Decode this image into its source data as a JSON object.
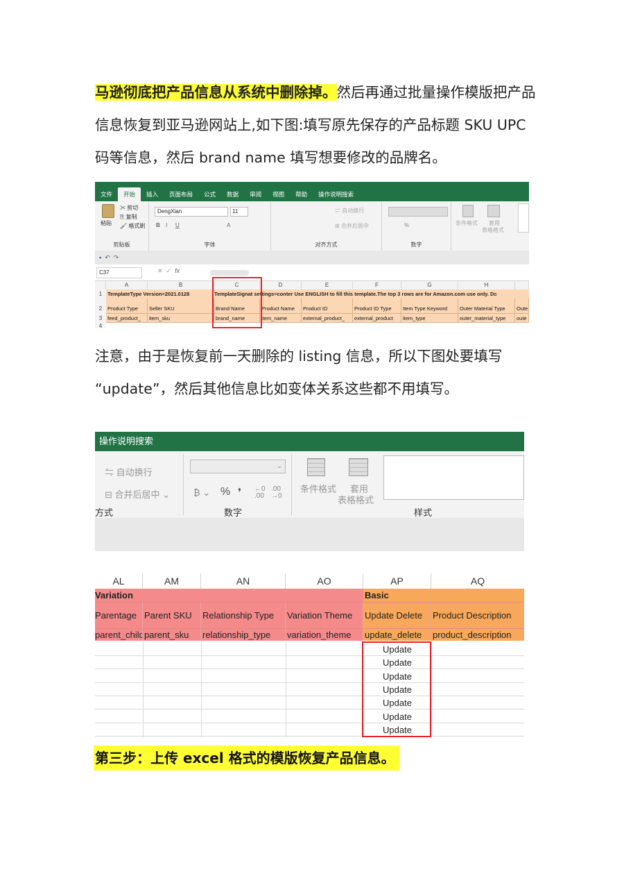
{
  "intro": {
    "highlight": "马逊彻底把产品信息从系统中删除掉。",
    "rest": "然后再通过批量操作模版把产品信息恢复到亚马逊网站上,如下图:填写原先保存的产品标题 SKU UPC码等信息，然后 brand name 填写想要修改的品牌名。"
  },
  "note": "注意，由于是恢复前一天删除的 listing 信息，所以下图处要填写 “update”，然后其他信息比如变体关系这些都不用填写。",
  "step3": "第三步：上传 excel 格式的模版恢复产品信息。",
  "shot1": {
    "tabs": [
      "文件",
      "开始",
      "插入",
      "页面布局",
      "公式",
      "数据",
      "审阅",
      "视图",
      "帮助",
      "操作说明搜索"
    ],
    "active_tab": "开始",
    "ribbon": {
      "paste": "粘贴",
      "cut": "剪切",
      "copy": "复制",
      "format_painter": "格式刷",
      "clipboard_group": "剪贴板",
      "font_name": "DengXian",
      "font_size": "11",
      "font_group": "字体",
      "wrap_text": "自动换行",
      "merge_center": "合并后居中",
      "align_group": "对齐方式",
      "number_group": "数字",
      "cond_format": "条件格式",
      "table_format_1": "套用",
      "table_format_2": "表格格式"
    },
    "name_box": "C37",
    "fx": "fx",
    "columns": [
      "A",
      "B",
      "C",
      "D",
      "E",
      "F",
      "G",
      "H"
    ],
    "rows": [
      "1",
      "2",
      "3",
      "4"
    ],
    "row1": "TemplateType Version=2021.0128",
    "row1_b": "TemplateSignat settings=conter Use ENGLISH to fill this template.The top 3 rows are for Amazon.com use only. Dc",
    "row2": [
      "Product Type",
      "Seller SKU",
      "Brand Name",
      "Product Name",
      "Product ID",
      "Product ID Type",
      "Item Type Keyword",
      "Outer Material Type",
      "Oute"
    ],
    "row3": [
      "feed_product_",
      "item_sku",
      "brand_name",
      "item_name",
      "external_product_",
      "external_product",
      "item_type",
      "outer_material_type",
      "oute"
    ]
  },
  "shot2": {
    "title": "操作说明搜索",
    "wrap_text": "自动换行",
    "merge_center": "合并后居中",
    "align_suffix": "方式",
    "number_group": "数字",
    "percent": "%",
    "comma": "❜",
    "cond_format": "条件格式",
    "table_format_1": "套用",
    "table_format_2": "表格格式",
    "styles_group": "样式",
    "columns": [
      "AL",
      "AM",
      "AN",
      "AO",
      "AP",
      "AQ"
    ],
    "band_variation": "Variation",
    "band_basic": "Basic",
    "headers": [
      "Parentage",
      "Parent SKU",
      "Relationship Type",
      "Variation Theme",
      "Update Delete",
      "Product Description"
    ],
    "fields": [
      "parent_child",
      "parent_sku",
      "relationship_type",
      "variation_theme",
      "update_delete",
      "product_description"
    ],
    "update_values": [
      "Update",
      "Update",
      "Update",
      "Update",
      "Update",
      "Update",
      "Update"
    ]
  },
  "colors": {
    "highlight": "#ffff33",
    "excel_green": "#217346",
    "variation_red": "#f48a8a",
    "basic_orange": "#f8a85a",
    "header_peach": "#fbd7b5",
    "annotation_red": "#e3222a"
  }
}
